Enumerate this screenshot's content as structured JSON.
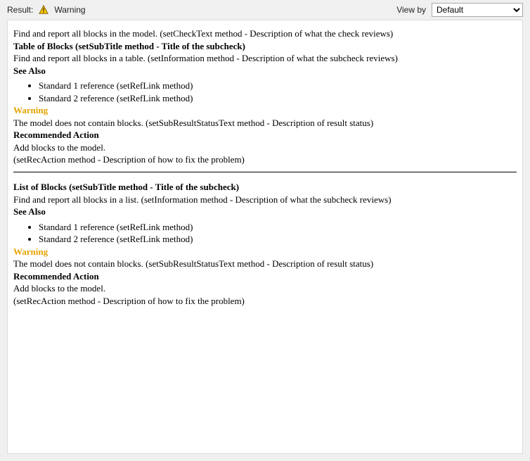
{
  "header": {
    "result_label": "Result:",
    "status_text": "Warning",
    "viewby_label": "View by",
    "viewby_selected": "Default"
  },
  "intro": "Find and report all blocks in the model. (setCheckText method - Description of what the check reviews)",
  "sections": [
    {
      "subtitle": "Table of Blocks (setSubTitle method - Title of the subcheck)",
      "information": "Find and report all blocks in a table. (setInformation method - Description of what the subcheck reviews)",
      "see_also_heading": "See Also",
      "references": [
        "Standard 1 reference (setRefLink method)",
        "Standard 2 reference (setRefLink method)"
      ],
      "warning_heading": "Warning",
      "warning_text": "The model does not contain blocks. (setSubResultStatusText method - Description of result status)",
      "rec_heading": "Recommended Action",
      "rec_line1": "Add blocks to the model.",
      "rec_line2": "(setRecAction method - Description of how to fix the problem)"
    },
    {
      "subtitle": "List of Blocks (setSubTitle method - Title of the subcheck)",
      "information": "Find and report all blocks in a list. (setInformation method - Description of what the subcheck reviews)",
      "see_also_heading": "See Also",
      "references": [
        "Standard 1 reference (setRefLink method)",
        "Standard 2 reference (setRefLink method)"
      ],
      "warning_heading": "Warning",
      "warning_text": "The model does not contain blocks. (setSubResultStatusText method - Description of result status)",
      "rec_heading": "Recommended Action",
      "rec_line1": "Add blocks to the model.",
      "rec_line2": "(setRecAction method - Description of how to fix the problem)"
    }
  ]
}
